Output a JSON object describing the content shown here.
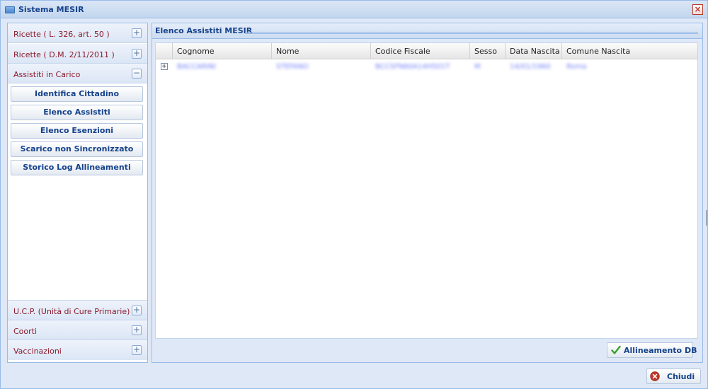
{
  "window": {
    "title": "Sistema MESIR",
    "close_symbol": "×"
  },
  "sidebar": {
    "sections": [
      {
        "label": "Ricette ( L. 326, art. 50 )",
        "toggle": "+"
      },
      {
        "label": "Ricette ( D.M. 2/11/2011 )",
        "toggle": "+"
      },
      {
        "label": "Assistiti in Carico",
        "toggle": "−"
      },
      {
        "label": "U.C.P. (Unità di Cure Primarie)",
        "toggle": "+"
      },
      {
        "label": "Coorti",
        "toggle": "+"
      },
      {
        "label": "Vaccinazioni",
        "toggle": "+"
      }
    ],
    "buttons": [
      "Identifica Cittadino",
      "Elenco Assistiti",
      "Elenco Esenzioni",
      "Scarico non Sincronizzato",
      "Storico Log Allineamenti"
    ]
  },
  "panel": {
    "title": "Elenco Assistiti MESIR",
    "columns": [
      "Cognome",
      "Nome",
      "Codice Fiscale",
      "Sesso",
      "Data Nascita",
      "Comune Nascita"
    ],
    "rows": [
      {
        "expander": "+",
        "cells": [
          "BACCARINI",
          "STEFANO",
          "BCCSFN60A14H501T",
          "M",
          "14/01/1960",
          "Roma"
        ]
      }
    ],
    "align_button": "Allineamento DB"
  },
  "footer": {
    "close_button": "Chiudi"
  },
  "colors": {
    "accent": "#15428b",
    "section_label": "#8b1a2b",
    "border": "#99bbe8",
    "check": "#3aa02a",
    "close_red": "#c0392b"
  }
}
